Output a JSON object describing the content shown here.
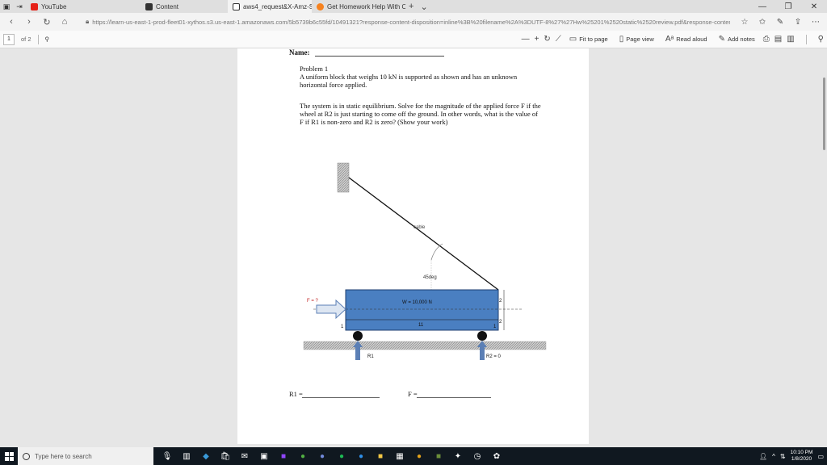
{
  "browser": {
    "tabs": [
      {
        "label": "YouTube",
        "color": "#e62117"
      },
      {
        "label": "Content",
        "color": "#333333"
      },
      {
        "label": "aws4_request&X-Amz-S",
        "color": "#ffffff"
      },
      {
        "label": "Get Homework Help With C",
        "color": "#f6821f"
      }
    ],
    "new_tab_glyph": "+",
    "tab_close_glyph": "×",
    "url_display": "https://learn-us-east-1-prod-fleet01-xythos.s3.us-east-1.amazonaws.com/5b5739b6c55fd/10491321?response-content-disposition=inline%3B%20filename%2A%3DUTF-8%27%27Hw%25201%2520static%2520review.pdf&response-content-type=application%2"
  },
  "pdf_toolbar": {
    "page_current": "1",
    "page_total": "of 2",
    "fit_to_page": "Fit to page",
    "page_view": "Page view",
    "read_aloud": "Read aloud",
    "add_notes": "Add notes"
  },
  "document": {
    "name_label": "Name:",
    "problem_title": "Problem 1",
    "problem_text": "A uniform block that weighs 10 kN is supported as shown and has an unknown horizontal force applied.",
    "instructions": "The system is in static equilibrium. Solve for the magnitude of the applied force F if the wheel at R2 is just starting to come off the ground. In other words, what is the value of F if R1 is non-zero and R2 is zero? (Show your work)",
    "answer_r1_label": "R1 =",
    "answer_f_label": "F ="
  },
  "diagram": {
    "cable_label": "cable",
    "angle_label": "45deg",
    "weight_label": "W = 10,000 N",
    "force_label": "F = ?",
    "dim_length": "11",
    "dim_left": "1",
    "dim_right": "1",
    "dim_height_top": "2",
    "dim_height_bottom": "2",
    "r1_label": "R1",
    "r2_label": "R2 = 0",
    "block_color": "#4a7fc1",
    "arrow_color": "#5b7fb5"
  },
  "taskbar": {
    "search_placeholder": "Type here to search",
    "time": "10:10 PM",
    "date": "1/8/2020"
  }
}
